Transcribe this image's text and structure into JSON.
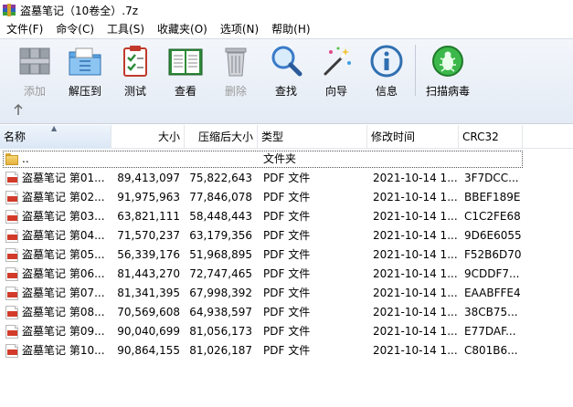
{
  "window": {
    "title": "盗墓笔记（10卷全）.7z"
  },
  "menu": [
    "文件(F)",
    "命令(C)",
    "工具(S)",
    "收藏夹(O)",
    "选项(N)",
    "帮助(H)"
  ],
  "toolbar": {
    "add": "添加",
    "extract": "解压到",
    "test": "测试",
    "view": "查看",
    "delete": "删除",
    "find": "查找",
    "wizard": "向导",
    "info": "信息",
    "scan": "扫描病毒"
  },
  "navigation": {
    "up_icon": "up-arrow-icon"
  },
  "columns": {
    "name": "名称",
    "size": "大小",
    "packed": "压缩后大小",
    "type": "类型",
    "modified": "修改时间",
    "crc": "CRC32"
  },
  "parent_row": {
    "name": "..",
    "type": "文件夹"
  },
  "files": [
    {
      "name": "盗墓笔记 第01...",
      "size": "89,413,097",
      "packed": "75,822,643",
      "type": "PDF 文件",
      "modified": "2021-10-14 1...",
      "crc": "3F7DCC..."
    },
    {
      "name": "盗墓笔记 第02...",
      "size": "91,975,963",
      "packed": "77,846,078",
      "type": "PDF 文件",
      "modified": "2021-10-14 1...",
      "crc": "BBEF189E"
    },
    {
      "name": "盗墓笔记 第03...",
      "size": "63,821,111",
      "packed": "58,448,443",
      "type": "PDF 文件",
      "modified": "2021-10-14 1...",
      "crc": "C1C2FE68"
    },
    {
      "name": "盗墓笔记 第04...",
      "size": "71,570,237",
      "packed": "63,179,356",
      "type": "PDF 文件",
      "modified": "2021-10-14 1...",
      "crc": "9D6E6055"
    },
    {
      "name": "盗墓笔记 第05...",
      "size": "56,339,176",
      "packed": "51,968,895",
      "type": "PDF 文件",
      "modified": "2021-10-14 1...",
      "crc": "F52B6D70"
    },
    {
      "name": "盗墓笔记 第06...",
      "size": "81,443,270",
      "packed": "72,747,465",
      "type": "PDF 文件",
      "modified": "2021-10-14 1...",
      "crc": "9CDDF7..."
    },
    {
      "name": "盗墓笔记 第07...",
      "size": "81,341,395",
      "packed": "67,998,392",
      "type": "PDF 文件",
      "modified": "2021-10-14 1...",
      "crc": "EAABFFE4"
    },
    {
      "name": "盗墓笔记 第08...",
      "size": "70,569,608",
      "packed": "64,938,597",
      "type": "PDF 文件",
      "modified": "2021-10-14 1...",
      "crc": "38CB75..."
    },
    {
      "name": "盗墓笔记 第09...",
      "size": "90,040,699",
      "packed": "81,056,173",
      "type": "PDF 文件",
      "modified": "2021-10-14 1...",
      "crc": "E77DAF..."
    },
    {
      "name": "盗墓笔记 第10...",
      "size": "90,864,155",
      "packed": "81,026,187",
      "type": "PDF 文件",
      "modified": "2021-10-14 1...",
      "crc": "C801B6..."
    }
  ]
}
